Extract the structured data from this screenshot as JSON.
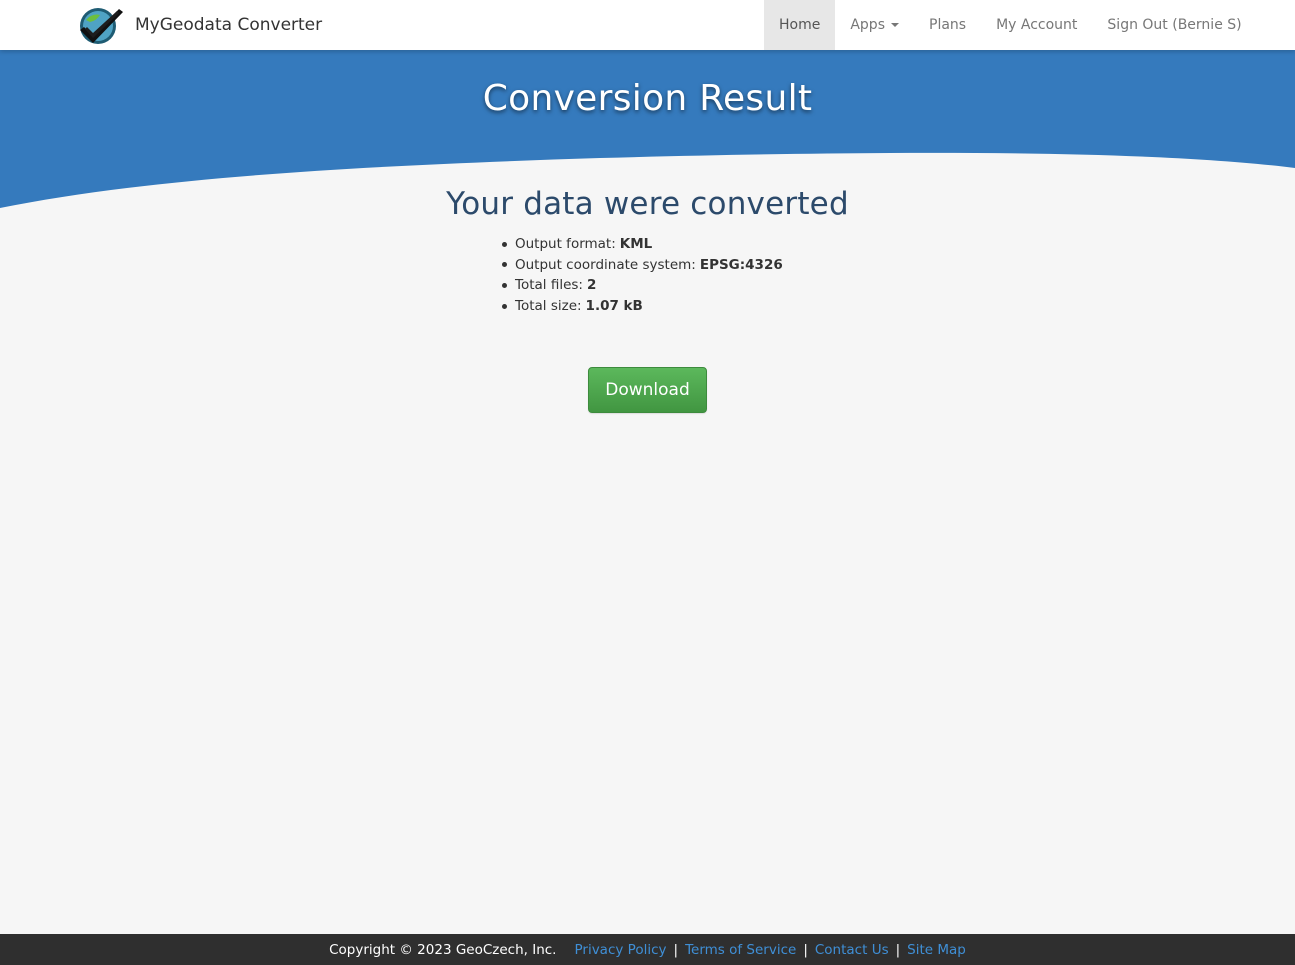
{
  "brand": {
    "name": "MyGeodata Converter",
    "logo_icon": "checkmark-globe-logo"
  },
  "nav": {
    "items": [
      {
        "label": "Home",
        "active": true
      },
      {
        "label": "Apps",
        "dropdown": true
      },
      {
        "label": "Plans"
      },
      {
        "label": "My Account"
      },
      {
        "label": "Sign Out (Bernie S)"
      }
    ]
  },
  "banner": {
    "title": "Conversion Result",
    "color": "#357abd"
  },
  "result": {
    "title": "Your data were converted",
    "details": [
      {
        "label": "Output format:",
        "value": "KML"
      },
      {
        "label": "Output coordinate system:",
        "value": "EPSG:4326"
      },
      {
        "label": "Total files:",
        "value": "2"
      },
      {
        "label": "Total size:",
        "value": "1.07 kB"
      }
    ],
    "download_label": "Download",
    "download_color": "#4cae4c"
  },
  "footer": {
    "copyright": "Copyright © 2023 GeoCzech, Inc.",
    "links": [
      "Privacy Policy",
      "Terms of Service",
      "Contact Us",
      "Site Map"
    ],
    "separator": "|"
  }
}
